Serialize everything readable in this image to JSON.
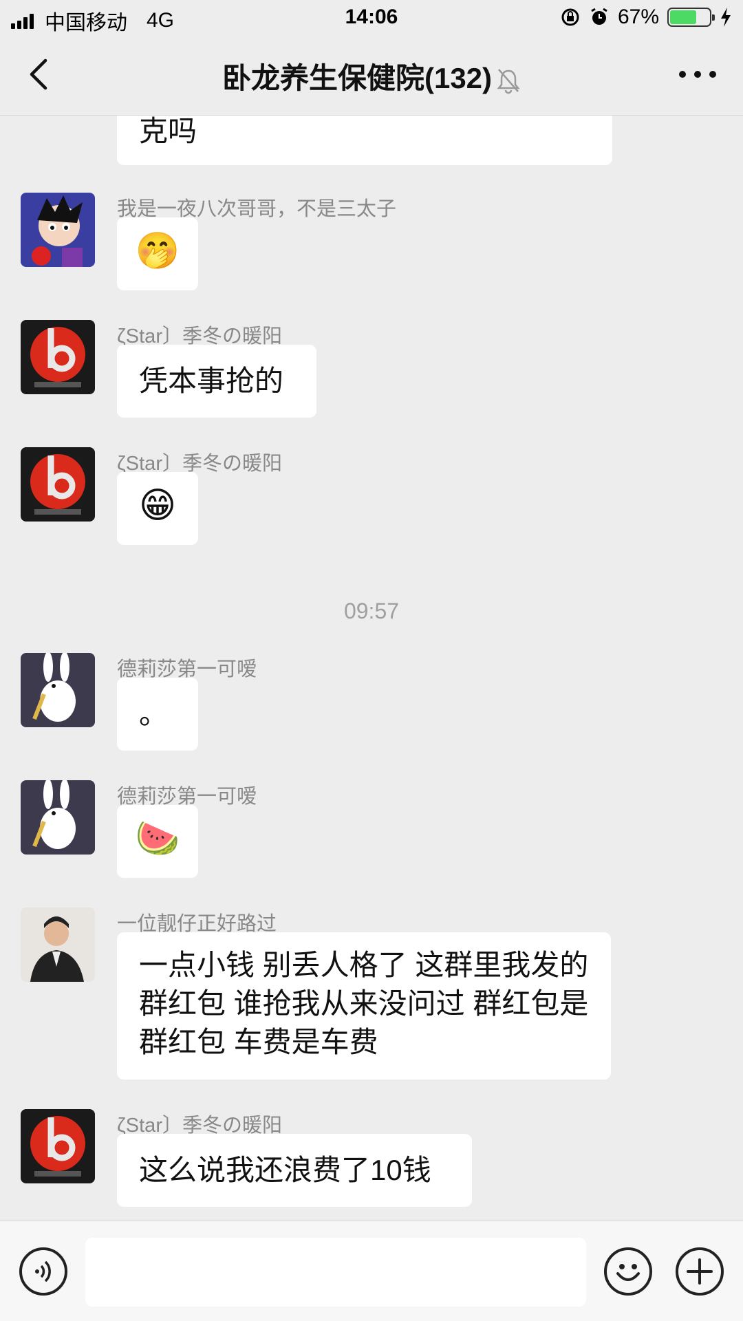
{
  "status_bar": {
    "carrier": "中国移动",
    "network": "4G",
    "time": "14:06",
    "battery": "67%",
    "battery_level": 0.67
  },
  "nav": {
    "title": "卧龙养生保健院(132)"
  },
  "messages": [
    {
      "text": "克吗"
    },
    {
      "sender": "我是一夜八次哥哥，不是三太子",
      "emoji": "🤭"
    },
    {
      "sender": "ζStar〕季冬の暖阳",
      "text": "凭本事抢的"
    },
    {
      "sender": "ζStar〕季冬の暖阳",
      "emoji": "😁"
    },
    {
      "time": "09:57"
    },
    {
      "sender": "德莉莎第一可嗳",
      "text": "。"
    },
    {
      "sender": "德莉莎第一可嗳",
      "emoji": "🍉"
    },
    {
      "sender": "一位靓仔正好路过",
      "text": "一点小钱 别丢人格了 这群里我发的群红包 谁抢我从来没问过 群红包是群红包 车费是车费"
    },
    {
      "sender": "ζStar〕季冬の暖阳",
      "text": "这么说我还浪费了10钱"
    }
  ],
  "input": {
    "value": ""
  },
  "colors": {
    "background": "#ededed",
    "bubble": "#ffffff",
    "battery": "#4cd964"
  }
}
